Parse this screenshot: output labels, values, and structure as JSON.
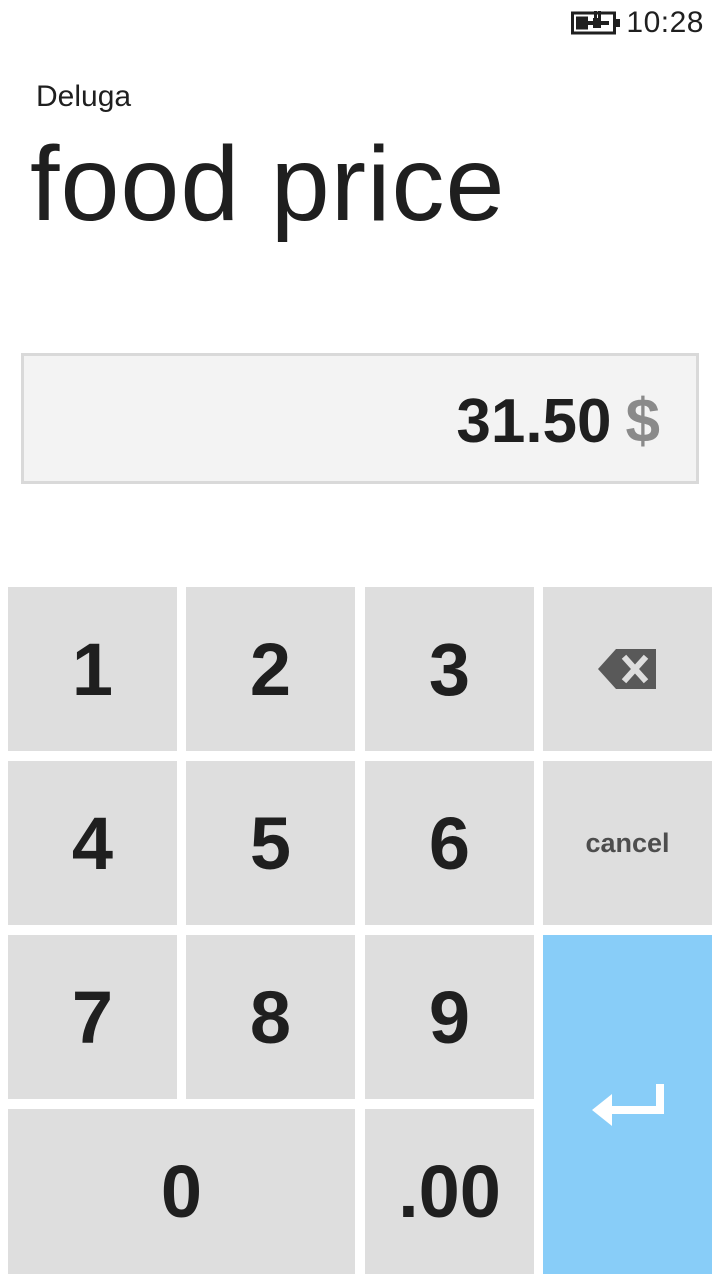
{
  "status_bar": {
    "time": "10:28",
    "battery_icon": "battery-charging-icon"
  },
  "header": {
    "app_name": "Deluga",
    "title": "food price"
  },
  "display": {
    "amount": "31.50",
    "currency": "$"
  },
  "keypad": {
    "digits": [
      "1",
      "2",
      "3",
      "4",
      "5",
      "6",
      "7",
      "8",
      "9",
      "0"
    ],
    "decimal_label": ".00",
    "cancel_label": "cancel",
    "backspace_icon": "backspace-icon",
    "enter_icon": "enter-icon",
    "enter_color": "#88cdf8"
  }
}
